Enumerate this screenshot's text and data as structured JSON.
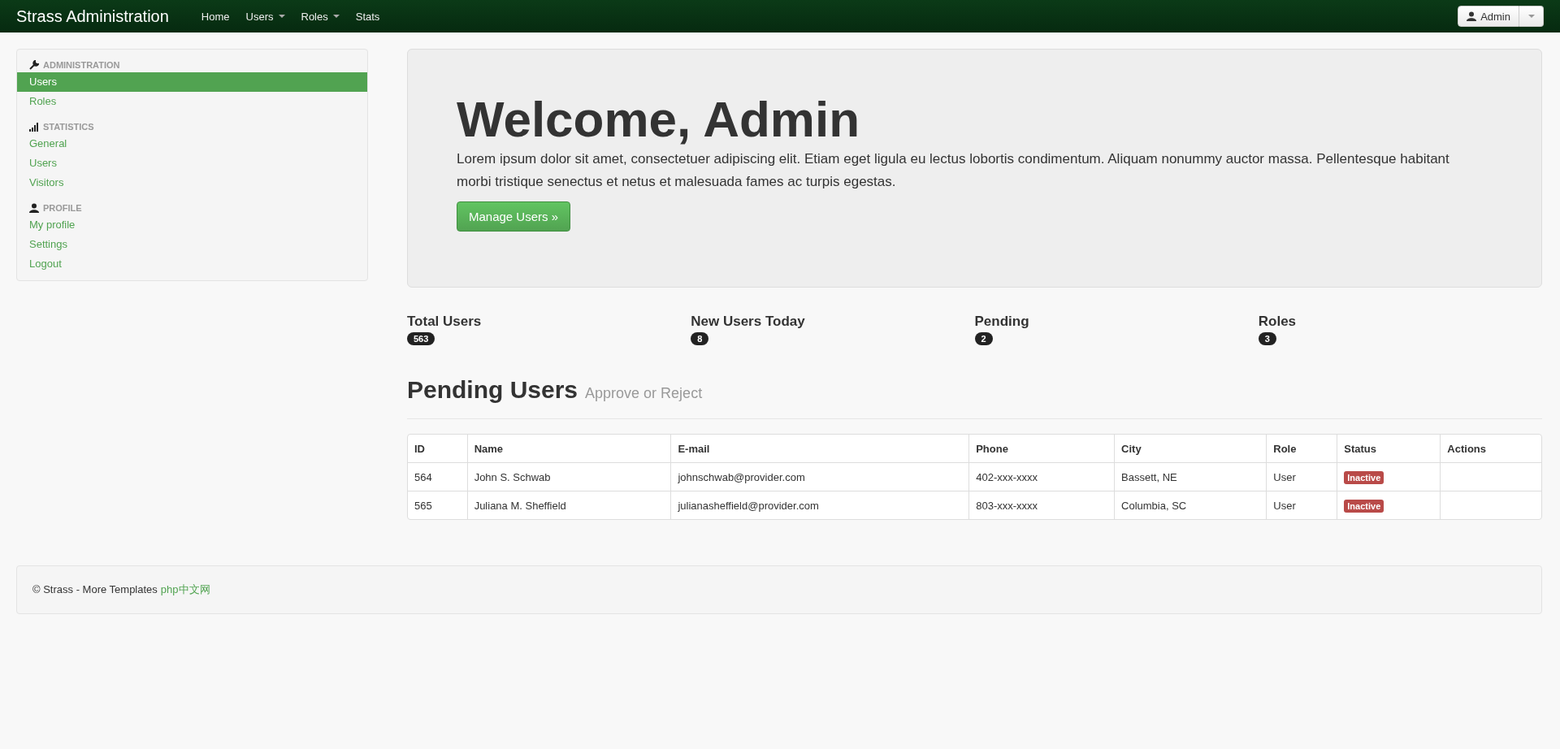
{
  "navbar": {
    "brand": "Strass Administration",
    "items": [
      {
        "label": "Home",
        "dropdown": false
      },
      {
        "label": "Users",
        "dropdown": true
      },
      {
        "label": "Roles",
        "dropdown": true
      },
      {
        "label": "Stats",
        "dropdown": false
      }
    ],
    "user_button": "Admin"
  },
  "sidebar": {
    "sections": [
      {
        "heading": "ADMINISTRATION",
        "kind": "wrench",
        "items": [
          {
            "label": "Users",
            "selected": true
          },
          {
            "label": "Roles",
            "selected": false
          }
        ]
      },
      {
        "heading": "STATISTICS",
        "kind": "signal",
        "items": [
          {
            "label": "General",
            "selected": false
          },
          {
            "label": "Users",
            "selected": false
          },
          {
            "label": "Visitors",
            "selected": false
          }
        ]
      },
      {
        "heading": "PROFILE",
        "kind": "user",
        "items": [
          {
            "label": "My profile",
            "selected": false
          },
          {
            "label": "Settings",
            "selected": false
          },
          {
            "label": "Logout",
            "selected": false
          }
        ]
      }
    ]
  },
  "hero": {
    "title": "Welcome, Admin",
    "text": "Lorem ipsum dolor sit amet, consectetuer adipiscing elit. Etiam eget ligula eu lectus lobortis condimentum. Aliquam nonummy auctor massa. Pellentesque habitant morbi tristique senectus et netus et malesuada fames ac turpis egestas.",
    "button": "Manage Users »"
  },
  "stats": [
    {
      "label": "Total Users",
      "count": "563"
    },
    {
      "label": "New Users Today",
      "count": "8"
    },
    {
      "label": "Pending",
      "count": "2"
    },
    {
      "label": "Roles",
      "count": "3"
    }
  ],
  "pending": {
    "title": "Pending Users",
    "subtitle": "Approve or Reject"
  },
  "table": {
    "columns": [
      "ID",
      "Name",
      "E-mail",
      "Phone",
      "City",
      "Role",
      "Status",
      "Actions"
    ],
    "rows": [
      {
        "id": "564",
        "name": "John S. Schwab",
        "email": "johnschwab@provider.com",
        "phone": "402-xxx-xxxx",
        "city": "Bassett, NE",
        "role": "User",
        "status": "Inactive"
      },
      {
        "id": "565",
        "name": "Juliana M. Sheffield",
        "email": "julianasheffield@provider.com",
        "phone": "803-xxx-xxxx",
        "city": "Columbia, SC",
        "role": "User",
        "status": "Inactive"
      }
    ]
  },
  "footer": {
    "text": "© Strass - More Templates",
    "link": "php中文网"
  }
}
